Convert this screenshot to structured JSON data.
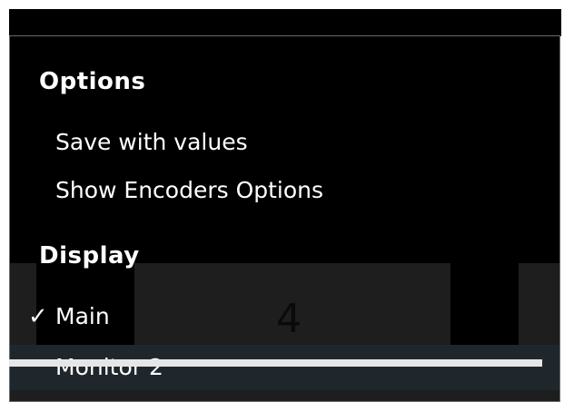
{
  "menu": {
    "sections": [
      {
        "title": "Options",
        "items": [
          {
            "label": "Save with values",
            "checked": false
          },
          {
            "label": "Show Encoders Options",
            "checked": false
          }
        ]
      },
      {
        "title": "Display",
        "items": [
          {
            "label": "Main",
            "checked": true,
            "check_glyph": "✓"
          },
          {
            "label": "Monitor 2",
            "checked": false,
            "highlighted": true
          }
        ]
      }
    ]
  },
  "background": {
    "digit": "4"
  },
  "colors": {
    "menu_bg": "#000000",
    "menu_text": "#ffffff",
    "highlight_bg": "#20272c",
    "border": "#6b6b6b"
  }
}
